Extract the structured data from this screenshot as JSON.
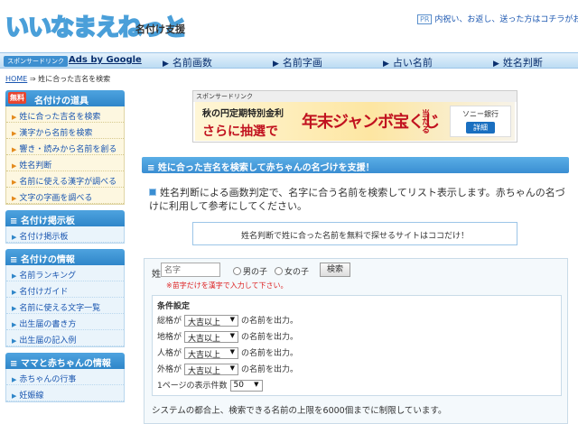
{
  "header": {
    "logo": "いいなまえねっと",
    "logo_sub": "名付け支援",
    "pr_badge": "PR",
    "pr_text": "内祝い、お返し、送った方はコチラがおすすめ"
  },
  "navbar": {
    "sponsor_tag": "スポンサードリンク",
    "ads_label": "Ads by Google",
    "links": [
      "名前画数",
      "名前字画",
      "占い名前",
      "姓名判断"
    ]
  },
  "breadcrumb": {
    "home": "HOME",
    "sep": "⇒",
    "current": "姓に合った吉名を検索"
  },
  "sidebar": {
    "section1": {
      "badge": "無料",
      "title": "名付けの道具",
      "items": [
        "姓に合った吉名を検索",
        "漢字から名前を検索",
        "響き・読みから名前を創る",
        "姓名判断",
        "名前に使える漢字が調べる",
        "文字の字画を調べる"
      ]
    },
    "section2": {
      "title": "名付け掲示板",
      "items": [
        "名付け掲示板"
      ]
    },
    "section3": {
      "title": "名付けの情報",
      "items": [
        "名前ランキング",
        "名付けガイド",
        "名前に使える文字一覧",
        "出生届の書き方",
        "出生届の記入例"
      ]
    },
    "section4": {
      "title": "ママと赤ちゃんの情報",
      "items": [
        "赤ちゃんの行事",
        "妊娠線"
      ]
    }
  },
  "ad": {
    "label": "スポンサードリンク",
    "line1": "秋の円定期特別金利",
    "line2": "さらに抽選で",
    "big": "年末ジャンボ宝くじ",
    "suffix": "当たる",
    "bank": "ソニー銀行",
    "detail": "詳細"
  },
  "main": {
    "title": "姓に合った吉名を検索して赤ちゃんの名づけを支援！",
    "intro": "姓名判断による画数判定で、名字に合う名前を検索してリスト表示します。赤ちゃんの名づけに利用して参考にしてください。",
    "notice": "姓名判断で姓に合った名前を無料で探せるサイトはココだけ！"
  },
  "search": {
    "sei_label": "姓",
    "sei_placeholder": "名字",
    "radio_boy": "男の子",
    "radio_girl": "女の子",
    "button": "検索",
    "note": "※苗字だけを漢字で入力して下さい。",
    "cond_title": "条件設定",
    "conditions": [
      {
        "label": "総格が",
        "value": "大吉以上",
        "suffix": "の名前を出力。"
      },
      {
        "label": "地格が",
        "value": "大吉以上",
        "suffix": "の名前を出力。"
      },
      {
        "label": "人格が",
        "value": "大吉以上",
        "suffix": "の名前を出力。"
      },
      {
        "label": "外格が",
        "value": "大吉以上",
        "suffix": "の名前を出力。"
      }
    ],
    "per_page_label": "1ページの表示件数",
    "per_page_value": "50",
    "limit_note": "システムの都合上、検索できる名前の上限を6000個までに制限しています。"
  },
  "colors": {
    "accent": "#3a8ed2",
    "nav_bg": "#bcdcf3",
    "sidebar_cream": "#fdf7e0",
    "warning_red": "#dd2222"
  }
}
